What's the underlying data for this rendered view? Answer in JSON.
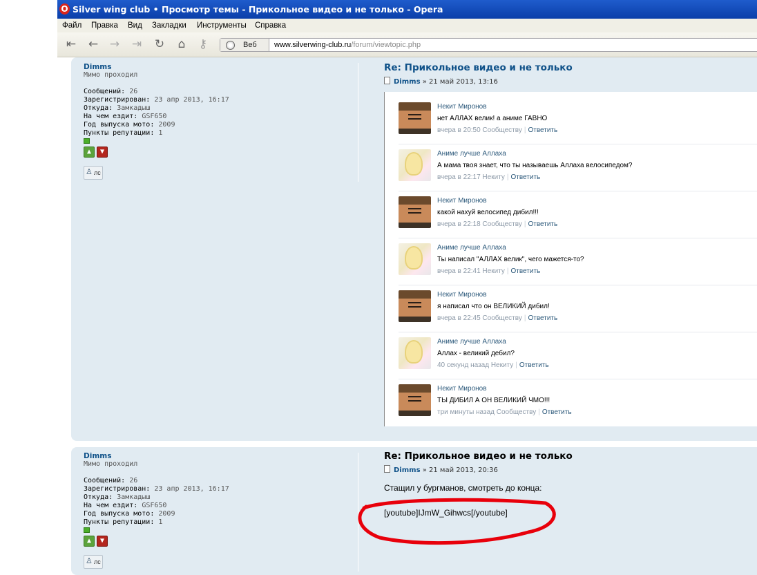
{
  "window": {
    "title": "Silver wing club • Просмотр темы - Прикольное видео и не только - Opera"
  },
  "menu": [
    "Файл",
    "Правка",
    "Вид",
    "Закладки",
    "Инструменты",
    "Справка"
  ],
  "address": {
    "engine": "Веб",
    "host": "www.silverwing-club.ru",
    "path": "/forum/viewtopic.php"
  },
  "posts": [
    {
      "author": {
        "name": "Dimms",
        "rank": "Мимо проходил",
        "fields": [
          {
            "k": "Сообщений:",
            "v": "26"
          },
          {
            "k": "Зарегистрирован:",
            "v": "23 апр 2013, 16:17"
          },
          {
            "k": "Откуда:",
            "v": "Замкадыш"
          },
          {
            "k": "На чем ездит:",
            "v": "GSF650"
          },
          {
            "k": "Год выпуска мото:",
            "v": "2009"
          },
          {
            "k": "Пункты репутации:",
            "v": "1"
          }
        ],
        "pm_label": "лс"
      },
      "title": "Re: Прикольное видео и не только",
      "meta_author": "Dimms",
      "meta_date": "» 21 май 2013, 13:16",
      "comments": [
        {
          "name": "Некит Миронов",
          "avatar": "man",
          "text": "нет АЛЛАХ велик! а аниме ГАВНО",
          "time": "вчера в 20:50 Сообществу",
          "reply": "Ответить"
        },
        {
          "name": "Аниме лучше Аллаха",
          "avatar": "anime",
          "text": "А мама твоя знает, что ты называешь Аллаха велосипедом?",
          "time": "вчера в 22:17 Некиту",
          "reply": "Ответить"
        },
        {
          "name": "Некит Миронов",
          "avatar": "man",
          "text": "какой нахуй велосипед дибил!!!",
          "time": "вчера в 22:18 Сообществу",
          "reply": "Ответить"
        },
        {
          "name": "Аниме лучше Аллаха",
          "avatar": "anime",
          "text": "Ты написал \"АЛЛАХ велик\", чего мажется-то?",
          "time": "вчера в 22:41 Некиту",
          "reply": "Ответить"
        },
        {
          "name": "Некит Миронов",
          "avatar": "man",
          "text": "я написал что он ВЕЛИКИЙ дибил!",
          "time": "вчера в 22:45 Сообществу",
          "reply": "Ответить"
        },
        {
          "name": "Аниме лучше Аллаха",
          "avatar": "anime",
          "text": "Аллах - великий дебил?",
          "time": "40 секунд назад Некиту",
          "reply": "Ответить"
        },
        {
          "name": "Некит Миронов",
          "avatar": "man",
          "text": "ТЫ ДИБИЛ А ОН ВЕЛИКИЙ ЧМО!!!",
          "time": "три минуты назад Сообществу",
          "reply": "Ответить"
        }
      ]
    },
    {
      "author": {
        "name": "Dimms",
        "rank": "Мимо проходил",
        "fields": [
          {
            "k": "Сообщений:",
            "v": "26"
          },
          {
            "k": "Зарегистрирован:",
            "v": "23 апр 2013, 16:17"
          },
          {
            "k": "Откуда:",
            "v": "Замкадыш"
          },
          {
            "k": "На чем ездит:",
            "v": "GSF650"
          },
          {
            "k": "Год выпуска мото:",
            "v": "2009"
          },
          {
            "k": "Пункты репутации:",
            "v": "1"
          }
        ],
        "pm_label": "лс"
      },
      "title": "Re: Прикольное видео и не только",
      "meta_author": "Dimms",
      "meta_date": "» 21 май 2013, 20:36",
      "body_line1": "Стащил у бургманов, смотреть до конца:",
      "body_line2": "[youtube]IJmW_Gihwcs[/youtube]"
    }
  ],
  "colors": {
    "post_bg": "#e1ebf2",
    "link": "#105289",
    "annotation": "#e8000b"
  }
}
